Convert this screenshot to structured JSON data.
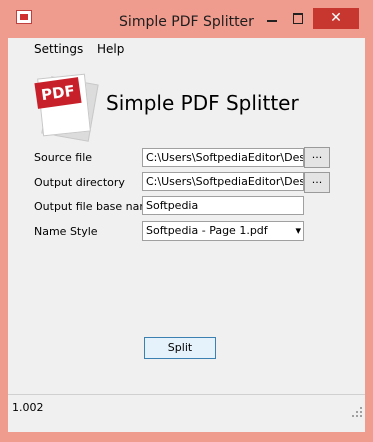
{
  "window": {
    "title": "Simple PDF Splitter",
    "close_glyph": "✕",
    "icons": [
      "app-icon",
      "minimize-icon",
      "maximize-icon",
      "close-icon"
    ]
  },
  "menu": {
    "items": [
      {
        "label": "Settings"
      },
      {
        "label": "Help"
      }
    ]
  },
  "header": {
    "logo_text": "PDF",
    "title": "Simple PDF Splitter"
  },
  "form": {
    "source_label": "Source file",
    "source_value": "C:\\Users\\SoftpediaEditor\\Desktop",
    "output_dir_label": "Output directory",
    "output_dir_value": "C:\\Users\\SoftpediaEditor\\Desktop",
    "base_name_label": "Output file base name",
    "base_name_value": "Softpedia",
    "name_style_label": "Name Style",
    "name_style_value": "Softpedia - Page 1.pdf",
    "browse_label": "..."
  },
  "actions": {
    "split_label": "Split"
  },
  "status": {
    "version": "1.002"
  },
  "colors": {
    "frame": "#ef9b8e",
    "close_button": "#c7372f",
    "client_bg": "#f0f0f0",
    "logo_red": "#c8202a",
    "focus_border": "#3c7fb1"
  }
}
